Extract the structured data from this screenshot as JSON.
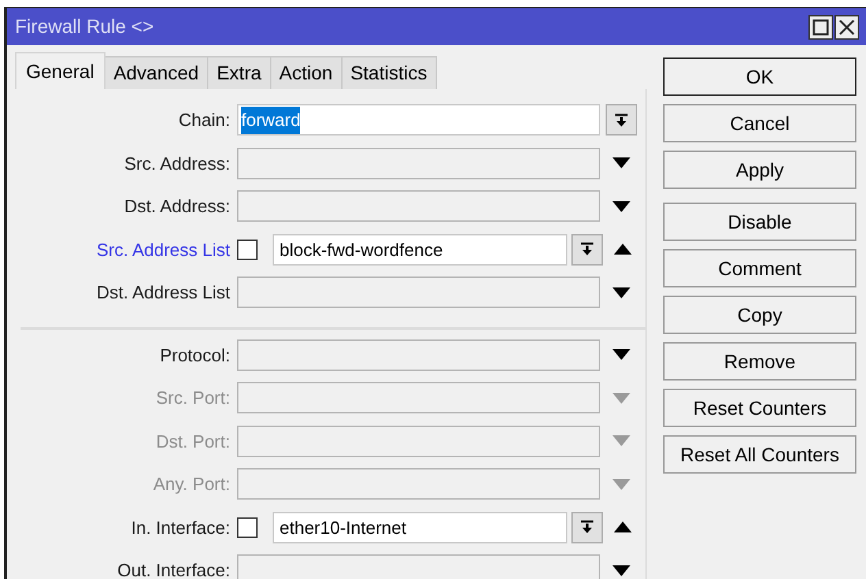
{
  "window": {
    "title": "Firewall Rule <>"
  },
  "tabs": [
    {
      "label": "General",
      "selected": true
    },
    {
      "label": "Advanced",
      "selected": false
    },
    {
      "label": "Extra",
      "selected": false
    },
    {
      "label": "Action",
      "selected": false
    },
    {
      "label": "Statistics",
      "selected": false
    }
  ],
  "groups": [
    {
      "rows": [
        {
          "kind": "select",
          "label": "Chain:",
          "value": "forward",
          "highlighted": true,
          "disabled": false,
          "emphasized": false
        },
        {
          "kind": "combo",
          "label": "Src. Address:",
          "disabled": false,
          "emphasized": false
        },
        {
          "kind": "combo",
          "label": "Dst. Address:",
          "disabled": false,
          "emphasized": false
        },
        {
          "kind": "list",
          "label": "Src. Address List",
          "value": "block-fwd-wordfence",
          "checked": false,
          "disabled": false,
          "emphasized": true
        },
        {
          "kind": "combo",
          "label": "Dst. Address List",
          "disabled": false,
          "emphasized": false
        }
      ]
    },
    {
      "rows": [
        {
          "kind": "combo",
          "label": "Protocol:",
          "disabled": false,
          "emphasized": false
        },
        {
          "kind": "combo",
          "label": "Src. Port:",
          "disabled": true,
          "emphasized": false
        },
        {
          "kind": "combo",
          "label": "Dst. Port:",
          "disabled": true,
          "emphasized": false
        },
        {
          "kind": "combo",
          "label": "Any. Port:",
          "disabled": true,
          "emphasized": false
        },
        {
          "kind": "list",
          "label": "In. Interface:",
          "value": "ether10-Internet",
          "checked": false,
          "disabled": false,
          "emphasized": false
        },
        {
          "kind": "combo",
          "label": "Out. Interface:",
          "disabled": false,
          "emphasized": false
        }
      ]
    }
  ],
  "button_groups": [
    [
      {
        "label": "OK",
        "default": true
      },
      {
        "label": "Cancel",
        "default": false
      },
      {
        "label": "Apply",
        "default": false
      }
    ],
    [
      {
        "label": "Disable",
        "default": false
      },
      {
        "label": "Comment",
        "default": false
      },
      {
        "label": "Copy",
        "default": false
      },
      {
        "label": "Remove",
        "default": false
      },
      {
        "label": "Reset Counters",
        "default": false
      },
      {
        "label": "Reset All Counters",
        "default": false
      }
    ]
  ]
}
